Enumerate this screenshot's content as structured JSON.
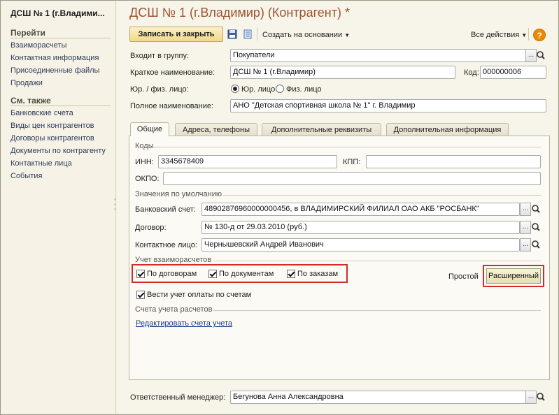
{
  "sidebar": {
    "title": "ДСШ № 1 (г.Владими...",
    "goto_header": "Перейти",
    "goto_items": [
      "Взаиморасчеты",
      "Контактная информация",
      "Присоединенные файлы",
      "Продажи"
    ],
    "see_also_header": "См. также",
    "see_also_items": [
      "Банковские счета",
      "Виды цен контрагентов",
      "Договоры контрагентов",
      "Документы по контрагенту",
      "Контактные лица",
      "События"
    ]
  },
  "form": {
    "title": "ДСШ № 1 (г.Владимир) (Контрагент) *",
    "toolbar": {
      "save_close": "Записать и закрыть",
      "create_based": "Создать на основании",
      "all_actions": "Все действия",
      "help": "?"
    },
    "group_label": "Входит в группу:",
    "group_value": "Покупатели",
    "short_name_label": "Краткое наименование:",
    "short_name_value": "ДСШ № 1 (г.Владимир)",
    "code_label": "Код:",
    "code_value": "000000006",
    "entity_label": "Юр. / физ. лицо:",
    "entity_options": [
      "Юр. лицо",
      "Физ. лицо"
    ],
    "entity_selected": "Юр. лицо",
    "full_name_label": "Полное наименование:",
    "full_name_value": "АНО \"Детская спортивная школа  № 1\" г. Владимир",
    "tabs": [
      "Общие",
      "Адреса, телефоны",
      "Дополнительные реквизиты",
      "Дополнительная информация"
    ],
    "active_tab": "Общие",
    "codes": {
      "title": "Коды",
      "inn_label": "ИНН:",
      "inn_value": "3345678409",
      "kpp_label": "КПП:",
      "kpp_value": "",
      "okpo_label": "ОКПО:",
      "okpo_value": ""
    },
    "defaults": {
      "title": "Значения по умолчанию",
      "bank_label": "Банковский счет:",
      "bank_value": "48902876960000000456, в ВЛАДИМИРСКИЙ ФИЛИАЛ ОАО АКБ \"РОСБАНК\"",
      "contract_label": "Договор:",
      "contract_value": "№ 130-д от 29.03.2010 (руб.)",
      "contact_label": "Контактное лицо:",
      "contact_value": "Чернышевский Андрей Иванович"
    },
    "settlements": {
      "title": "Учет взаиморасчетов",
      "by_contracts": "По договорам",
      "by_documents": "По документам",
      "by_orders": "По заказам",
      "simple": "Простой",
      "extended": "Расширенный",
      "invoice_tracking": "Вести учет оплаты по счетам"
    },
    "accounts": {
      "title": "Счета учета расчетов",
      "edit_link": "Редактировать счета учета"
    },
    "manager_label": "Ответственный менеджер:",
    "manager_value": "Бегунова Анна Александровна",
    "colors": {
      "title": "#a0522d",
      "highlight": "#d42a2a",
      "link": "#1b3f8b",
      "help": "#ee8a00"
    }
  }
}
